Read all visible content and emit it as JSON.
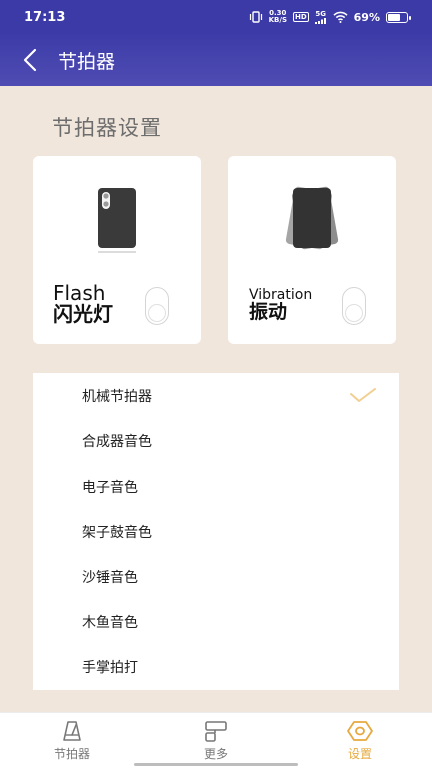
{
  "status_bar": {
    "time": "17:13",
    "net_speed_value": "0.30",
    "net_speed_unit": "KB/S",
    "hd_label": "HD",
    "signal_label": "5G",
    "battery_percent": "69%",
    "battery_level": 0.69
  },
  "header": {
    "title": "节拍器"
  },
  "settings": {
    "section_title": "节拍器设置",
    "flash_card": {
      "label_en": "Flash",
      "label_cn": "闪光灯",
      "enabled": false
    },
    "vibration_card": {
      "label_en": "Vibration",
      "label_cn": "振动",
      "enabled": false
    }
  },
  "sound_options": [
    {
      "label": "机械节拍器",
      "selected": true
    },
    {
      "label": "合成器音色",
      "selected": false
    },
    {
      "label": "电子音色",
      "selected": false
    },
    {
      "label": "架子鼓音色",
      "selected": false
    },
    {
      "label": "沙锤音色",
      "selected": false
    },
    {
      "label": "木鱼音色",
      "selected": false
    },
    {
      "label": "手掌拍打",
      "selected": false
    }
  ],
  "bottom_nav": {
    "items": [
      {
        "label": "节拍器",
        "icon": "metronome-icon",
        "active": false
      },
      {
        "label": "更多",
        "icon": "more-icon",
        "active": false
      },
      {
        "label": "设置",
        "icon": "settings-hexagon-icon",
        "active": true
      }
    ]
  },
  "colors": {
    "header_bg": "#3d3ba7",
    "page_bg": "#f1e6dc",
    "accent": "#e7a93f",
    "check": "#f1cf91"
  }
}
